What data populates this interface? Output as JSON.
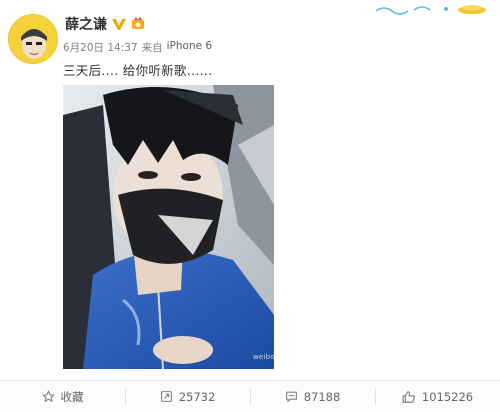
{
  "post": {
    "author": "薛之谦",
    "date": "6月20日 14:37",
    "source_prefix": "来自",
    "source": "iPhone 6",
    "text": "三天后.... 给你听新歌......",
    "image_watermark": "weibo.com/..."
  },
  "actions": {
    "favorite_label": "收藏",
    "repost_count": "25732",
    "comment_count": "87188",
    "like_count": "1015226"
  },
  "colors": {
    "verified_badge": "#f0a800",
    "avatar_bg": "#f5d23a",
    "meta_text": "#808080"
  },
  "icons": [
    "verified-v-icon",
    "medal-icon",
    "star-icon",
    "repost-icon",
    "comment-icon",
    "like-icon"
  ]
}
